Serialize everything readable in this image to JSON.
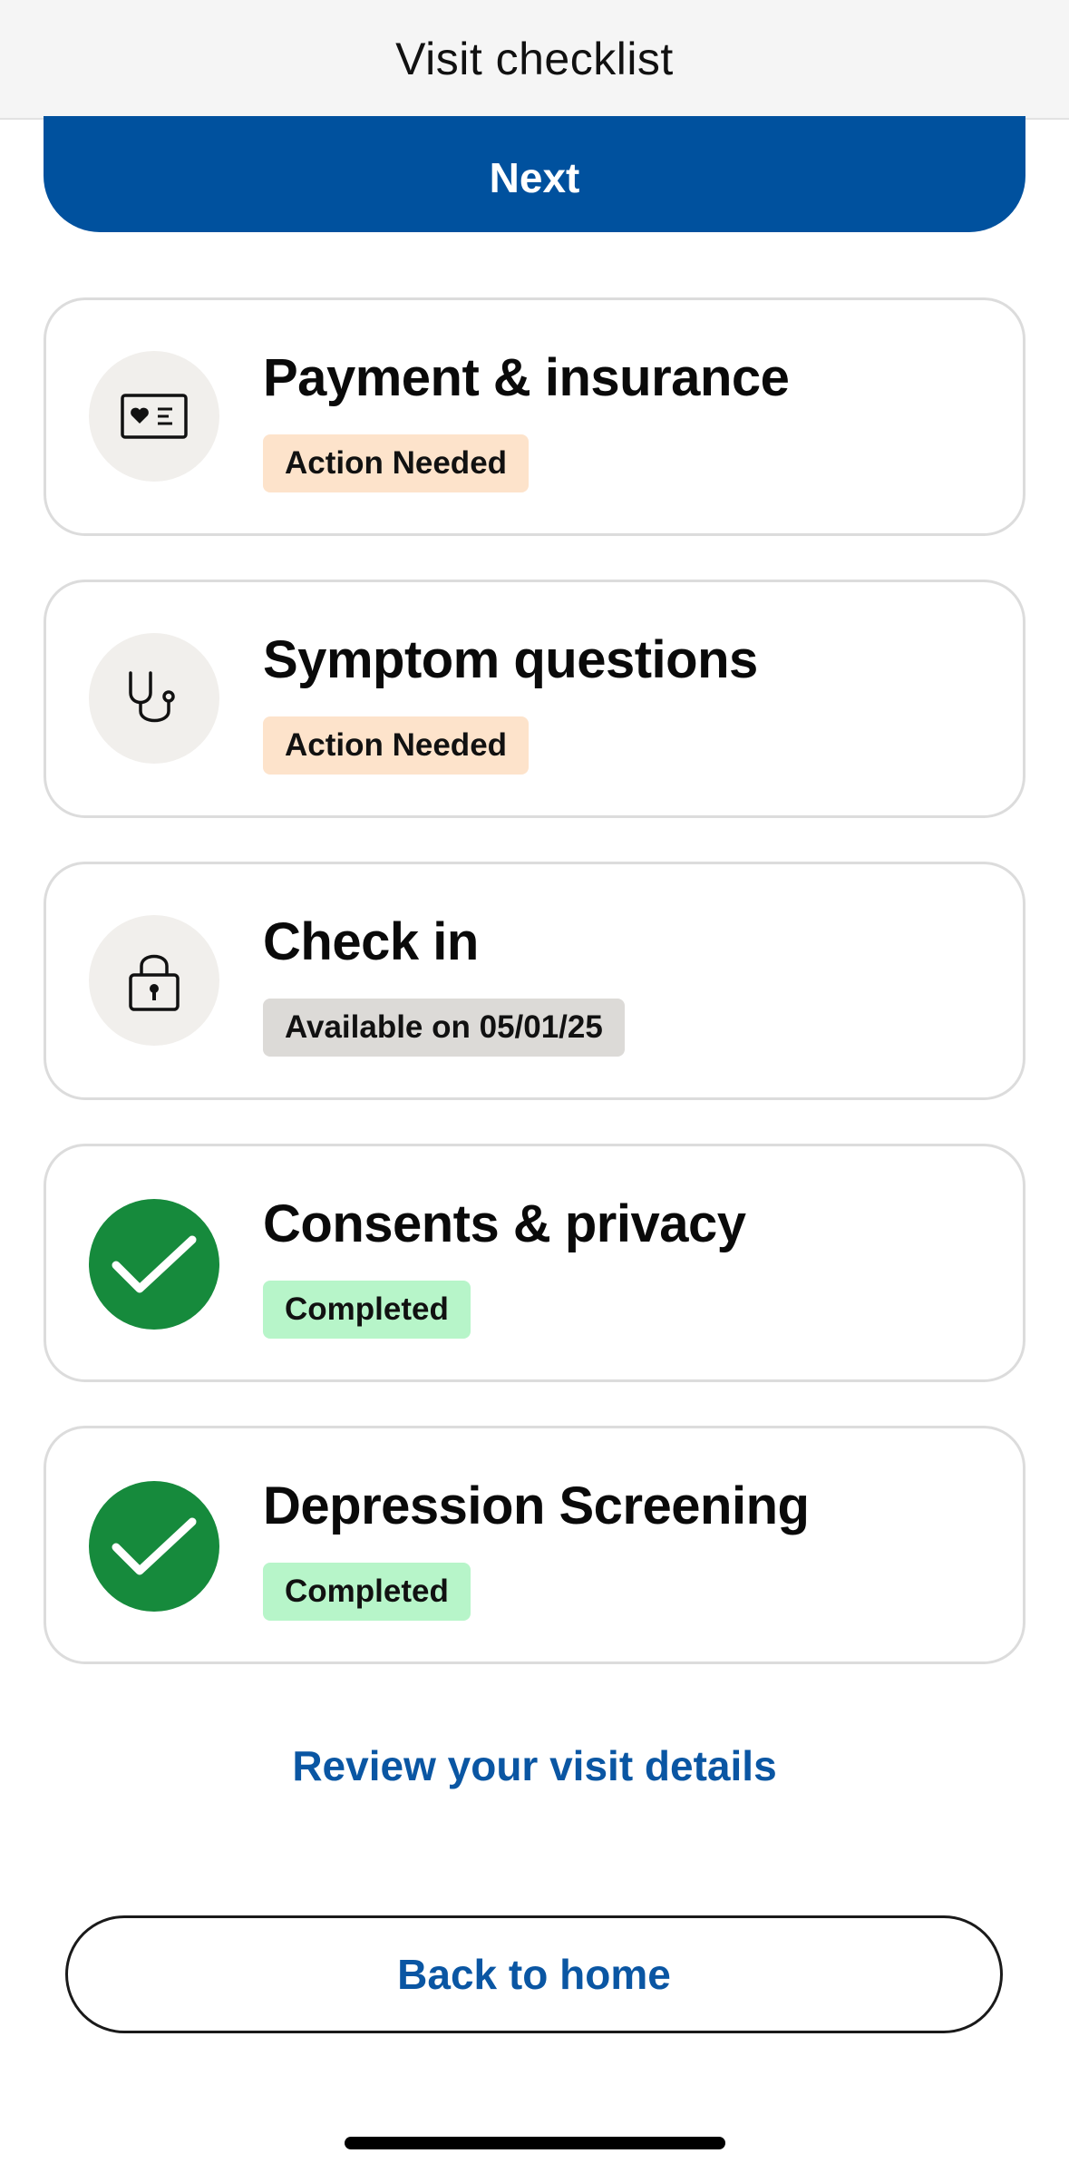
{
  "header": {
    "title": "Visit checklist"
  },
  "next_button": {
    "label": "Next"
  },
  "checklist": [
    {
      "title": "Payment & insurance",
      "status": "Action Needed",
      "status_type": "action",
      "icon": "insurance-card-icon"
    },
    {
      "title": "Symptom questions",
      "status": "Action Needed",
      "status_type": "action",
      "icon": "stethoscope-icon"
    },
    {
      "title": "Check in",
      "status": "Available on 05/01/25",
      "status_type": "available",
      "icon": "lock-icon"
    },
    {
      "title": "Consents & privacy",
      "status": "Completed",
      "status_type": "completed",
      "icon": "checkmark-icon"
    },
    {
      "title": "Depression Screening",
      "status": "Completed",
      "status_type": "completed",
      "icon": "checkmark-icon"
    }
  ],
  "review_link": {
    "label": "Review your visit details"
  },
  "home_button": {
    "label": "Back to home"
  },
  "colors": {
    "primary": "#00519e",
    "link": "#0a56a3",
    "action_badge": "#fde3cb",
    "available_badge": "#dcdad7",
    "completed_badge": "#b7f5c9",
    "completed_icon": "#168a3c"
  }
}
